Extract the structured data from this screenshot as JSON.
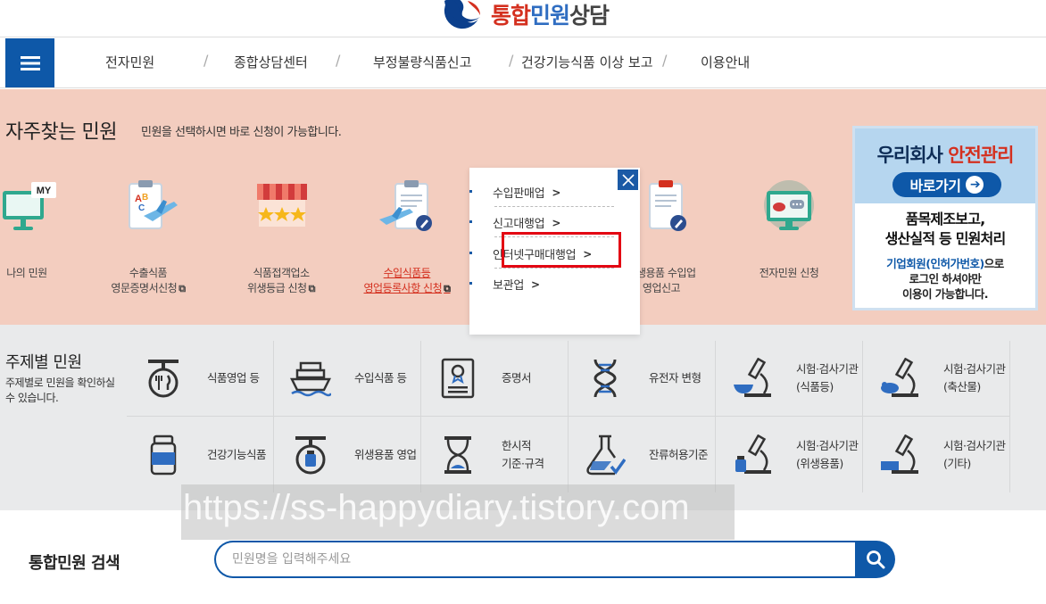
{
  "header": {
    "logo_part1": "통합",
    "logo_part2": "민원",
    "logo_part3": "상담"
  },
  "nav": {
    "items": [
      {
        "label": "전자민원"
      },
      {
        "label": "종합상담센터"
      },
      {
        "label": "부정불량식품신고"
      },
      {
        "label": "건강기능식품 이상 보고"
      },
      {
        "label": "이용안내"
      }
    ],
    "separator": "/"
  },
  "frequent": {
    "title": "자주찾는 민원",
    "description": "민원을 선택하시면 바로 신청이 가능합니다.",
    "items": [
      {
        "icon": "my-monitor-icon",
        "line1": "나의 민원",
        "line2": ""
      },
      {
        "icon": "export-plane-clipboard-icon",
        "line1": "수출식품",
        "line2": "영문증명서신청"
      },
      {
        "icon": "store-stars-icon",
        "line1": "식품접객업소",
        "line2": "위생등급 신청"
      },
      {
        "icon": "import-plane-clipboard-icon",
        "line1": "수입식품등",
        "line2": "영업등록사항 신청"
      },
      {
        "icon": "hygiene-clipboard-icon",
        "line1": "위생용품 수입업",
        "line2": "영업신고"
      },
      {
        "icon": "monitor-chat-icon",
        "line1": "전자민원 신청",
        "line2": ""
      }
    ],
    "popup": {
      "items": [
        {
          "label": "수입판매업"
        },
        {
          "label": "신고대행업"
        },
        {
          "label": "인터넷구매대행업"
        },
        {
          "label": "보관업"
        }
      ],
      "arrow": ">"
    }
  },
  "banner": {
    "title_part1": "우리회사 ",
    "title_part2": "안전관리",
    "go_label": "바로가기",
    "line1a": "품목제조보고,",
    "line1b": "생산실적 등 민원처리",
    "line2_blue": "기업회원(인허가번호)",
    "line2_rest": "으로",
    "line2b": "로그인 하셔야만",
    "line2c": "이용이 가능합니다."
  },
  "topic": {
    "title": "주제별 민원",
    "description": "주제별로 민원을 확인하실 수 있습니다.",
    "cells": [
      {
        "icon": "food-business-icon",
        "label": "식품영업 등"
      },
      {
        "icon": "import-ship-icon",
        "label": "수입식품 등"
      },
      {
        "icon": "certificate-icon",
        "label": "증명서"
      },
      {
        "icon": "dna-icon",
        "label": "유전자 변형"
      },
      {
        "icon": "microscope-food-icon",
        "label": "시험·검사기관\n(식품등)"
      },
      {
        "icon": "microscope-livestock-icon",
        "label": "시험·검사기관\n(축산물)"
      },
      {
        "icon": "supplement-bottle-icon",
        "label": "건강기능식품"
      },
      {
        "icon": "hygiene-business-icon",
        "label": "위생용품 영업"
      },
      {
        "icon": "hourglass-icon",
        "label": "한시적\n기준·규격"
      },
      {
        "icon": "flask-check-icon",
        "label": "잔류허용기준"
      },
      {
        "icon": "microscope-hygiene-icon",
        "label": "시험·검사기관\n(위생용품)"
      },
      {
        "icon": "microscope-other-icon",
        "label": "시험·검사기관\n(기타)"
      }
    ]
  },
  "watermark": "https://ss-happydiary.tistory.com",
  "search": {
    "label": "통합민원 검색",
    "placeholder": "민원명을 입력해주세요"
  },
  "colors": {
    "primary": "#0e58a8",
    "accent_red": "#d4301f",
    "frequent_bg": "#f3cdbf",
    "topic_bg": "#e9eaeb",
    "highlight": "#e30613"
  }
}
